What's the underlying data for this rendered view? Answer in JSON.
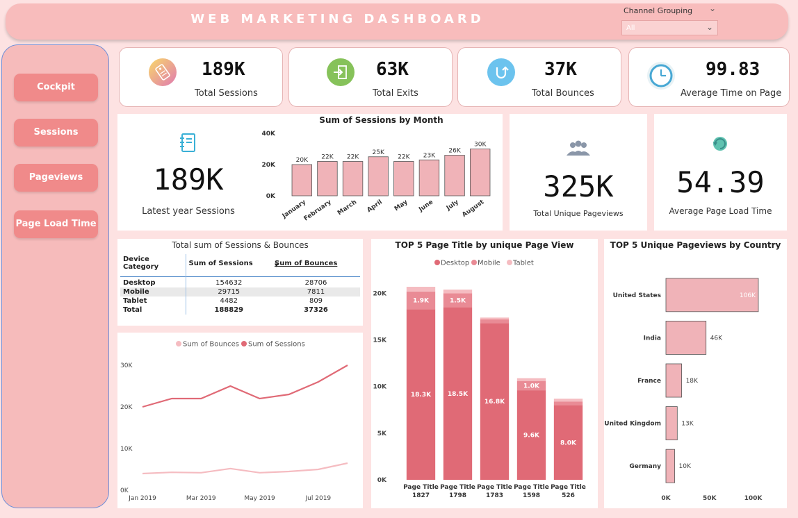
{
  "header": {
    "title": "WEB MARKETING DASHBOARD",
    "filter_label": "Channel Grouping",
    "filter_value": "All"
  },
  "sidebar": {
    "items": [
      {
        "label": "Cockpit"
      },
      {
        "label": "Sessions"
      },
      {
        "label": "Pageviews"
      },
      {
        "label": "Page Load Time"
      }
    ]
  },
  "kpis": [
    {
      "value": "189K",
      "label": "Total Sessions",
      "icon": "tag-icon"
    },
    {
      "value": "63K",
      "label": "Total Exits",
      "icon": "exit-icon"
    },
    {
      "value": "37K",
      "label": "Total Bounces",
      "icon": "bounce-icon"
    },
    {
      "value": "99.83",
      "label": "Average Time on Page",
      "icon": "clock-icon"
    }
  ],
  "latest_year": {
    "value": "189K",
    "label": "Latest year Sessions"
  },
  "unique_pageviews": {
    "value": "325K",
    "label": "Total Unique Pageviews"
  },
  "page_load": {
    "value": "54.39",
    "label": "Average Page Load Time"
  },
  "device_table": {
    "title": "Total sum of Sessions & Bounces",
    "headers": [
      "Device Category",
      "Sum of Sessions",
      "Sum of Bounces"
    ],
    "rows": [
      [
        "Desktop",
        "154632",
        "28706"
      ],
      [
        "Mobile",
        "29715",
        "7811"
      ],
      [
        "Tablet",
        "4482",
        "809"
      ]
    ],
    "total": [
      "Total",
      "188829",
      "37326"
    ]
  },
  "colors": {
    "accent": "#f08a8a",
    "bar_light": "#f0b3b8",
    "bar_dark": "#e06a76",
    "bar_lighter": "#f5bcc1"
  },
  "chart_data": [
    {
      "type": "bar",
      "title": "Sum of Sessions by Month",
      "categories": [
        "January",
        "February",
        "March",
        "April",
        "May",
        "June",
        "July",
        "August"
      ],
      "values": [
        20,
        22,
        22,
        25,
        22,
        23,
        26,
        30
      ],
      "data_labels": [
        "20K",
        "22K",
        "22K",
        "25K",
        "22K",
        "23K",
        "26K",
        "30K"
      ],
      "yticks": [
        "0K",
        "20K",
        "40K"
      ],
      "ylim": [
        0,
        40
      ]
    },
    {
      "type": "line",
      "title": "",
      "legend": [
        "Sum of Bounces",
        "Sum of Sessions"
      ],
      "x": [
        "Jan 2019",
        "Feb 2019",
        "Mar 2019",
        "Apr 2019",
        "May 2019",
        "Jun 2019",
        "Jul 2019",
        "Aug 2019"
      ],
      "xticks": [
        "Jan 2019",
        "Mar 2019",
        "May 2019",
        "Jul 2019"
      ],
      "yticks": [
        "0K",
        "10K",
        "20K",
        "30K"
      ],
      "series": [
        {
          "name": "Sum of Bounces",
          "values": [
            4.0,
            4.3,
            4.2,
            5.2,
            4.2,
            4.5,
            5.0,
            6.5
          ]
        },
        {
          "name": "Sum of Sessions",
          "values": [
            20,
            22,
            22,
            25,
            22,
            23,
            26,
            30
          ]
        }
      ],
      "ylim": [
        0,
        32
      ]
    },
    {
      "type": "bar",
      "stacked": true,
      "title": "TOP 5 Page Title by unique Page View",
      "legend": [
        "Desktop",
        "Mobile",
        "Tablet"
      ],
      "categories": [
        "Page Title 1827",
        "Page Title 1798",
        "Page Title 1783",
        "Page Title 1598",
        "Page Title 526"
      ],
      "series": [
        {
          "name": "Desktop",
          "values": [
            18.3,
            18.5,
            16.8,
            9.6,
            8.0
          ],
          "labels": [
            "18.3K",
            "18.5K",
            "16.8K",
            "9.6K",
            "8.0K"
          ]
        },
        {
          "name": "Mobile",
          "values": [
            1.9,
            1.5,
            0.4,
            1.0,
            0.4
          ],
          "labels": [
            "1.9K",
            "1.5K",
            "",
            "1.0K",
            ""
          ]
        },
        {
          "name": "Tablet",
          "values": [
            0.5,
            0.4,
            0.2,
            0.3,
            0.3
          ],
          "labels": [
            "",
            "",
            "",
            "",
            ""
          ]
        }
      ],
      "yticks": [
        "0K",
        "5K",
        "10K",
        "15K",
        "20K"
      ],
      "ylim": [
        0,
        21
      ]
    },
    {
      "type": "bar",
      "orientation": "horizontal",
      "title": "TOP 5 Unique Pageviews by Country",
      "categories": [
        "United States",
        "India",
        "France",
        "United Kingdom",
        "Germany"
      ],
      "values": [
        106,
        46,
        18,
        13,
        10
      ],
      "data_labels": [
        "106K",
        "46K",
        "18K",
        "13K",
        "10K"
      ],
      "xticks": [
        "0K",
        "50K",
        "100K"
      ],
      "xlim": [
        0,
        110
      ]
    }
  ]
}
